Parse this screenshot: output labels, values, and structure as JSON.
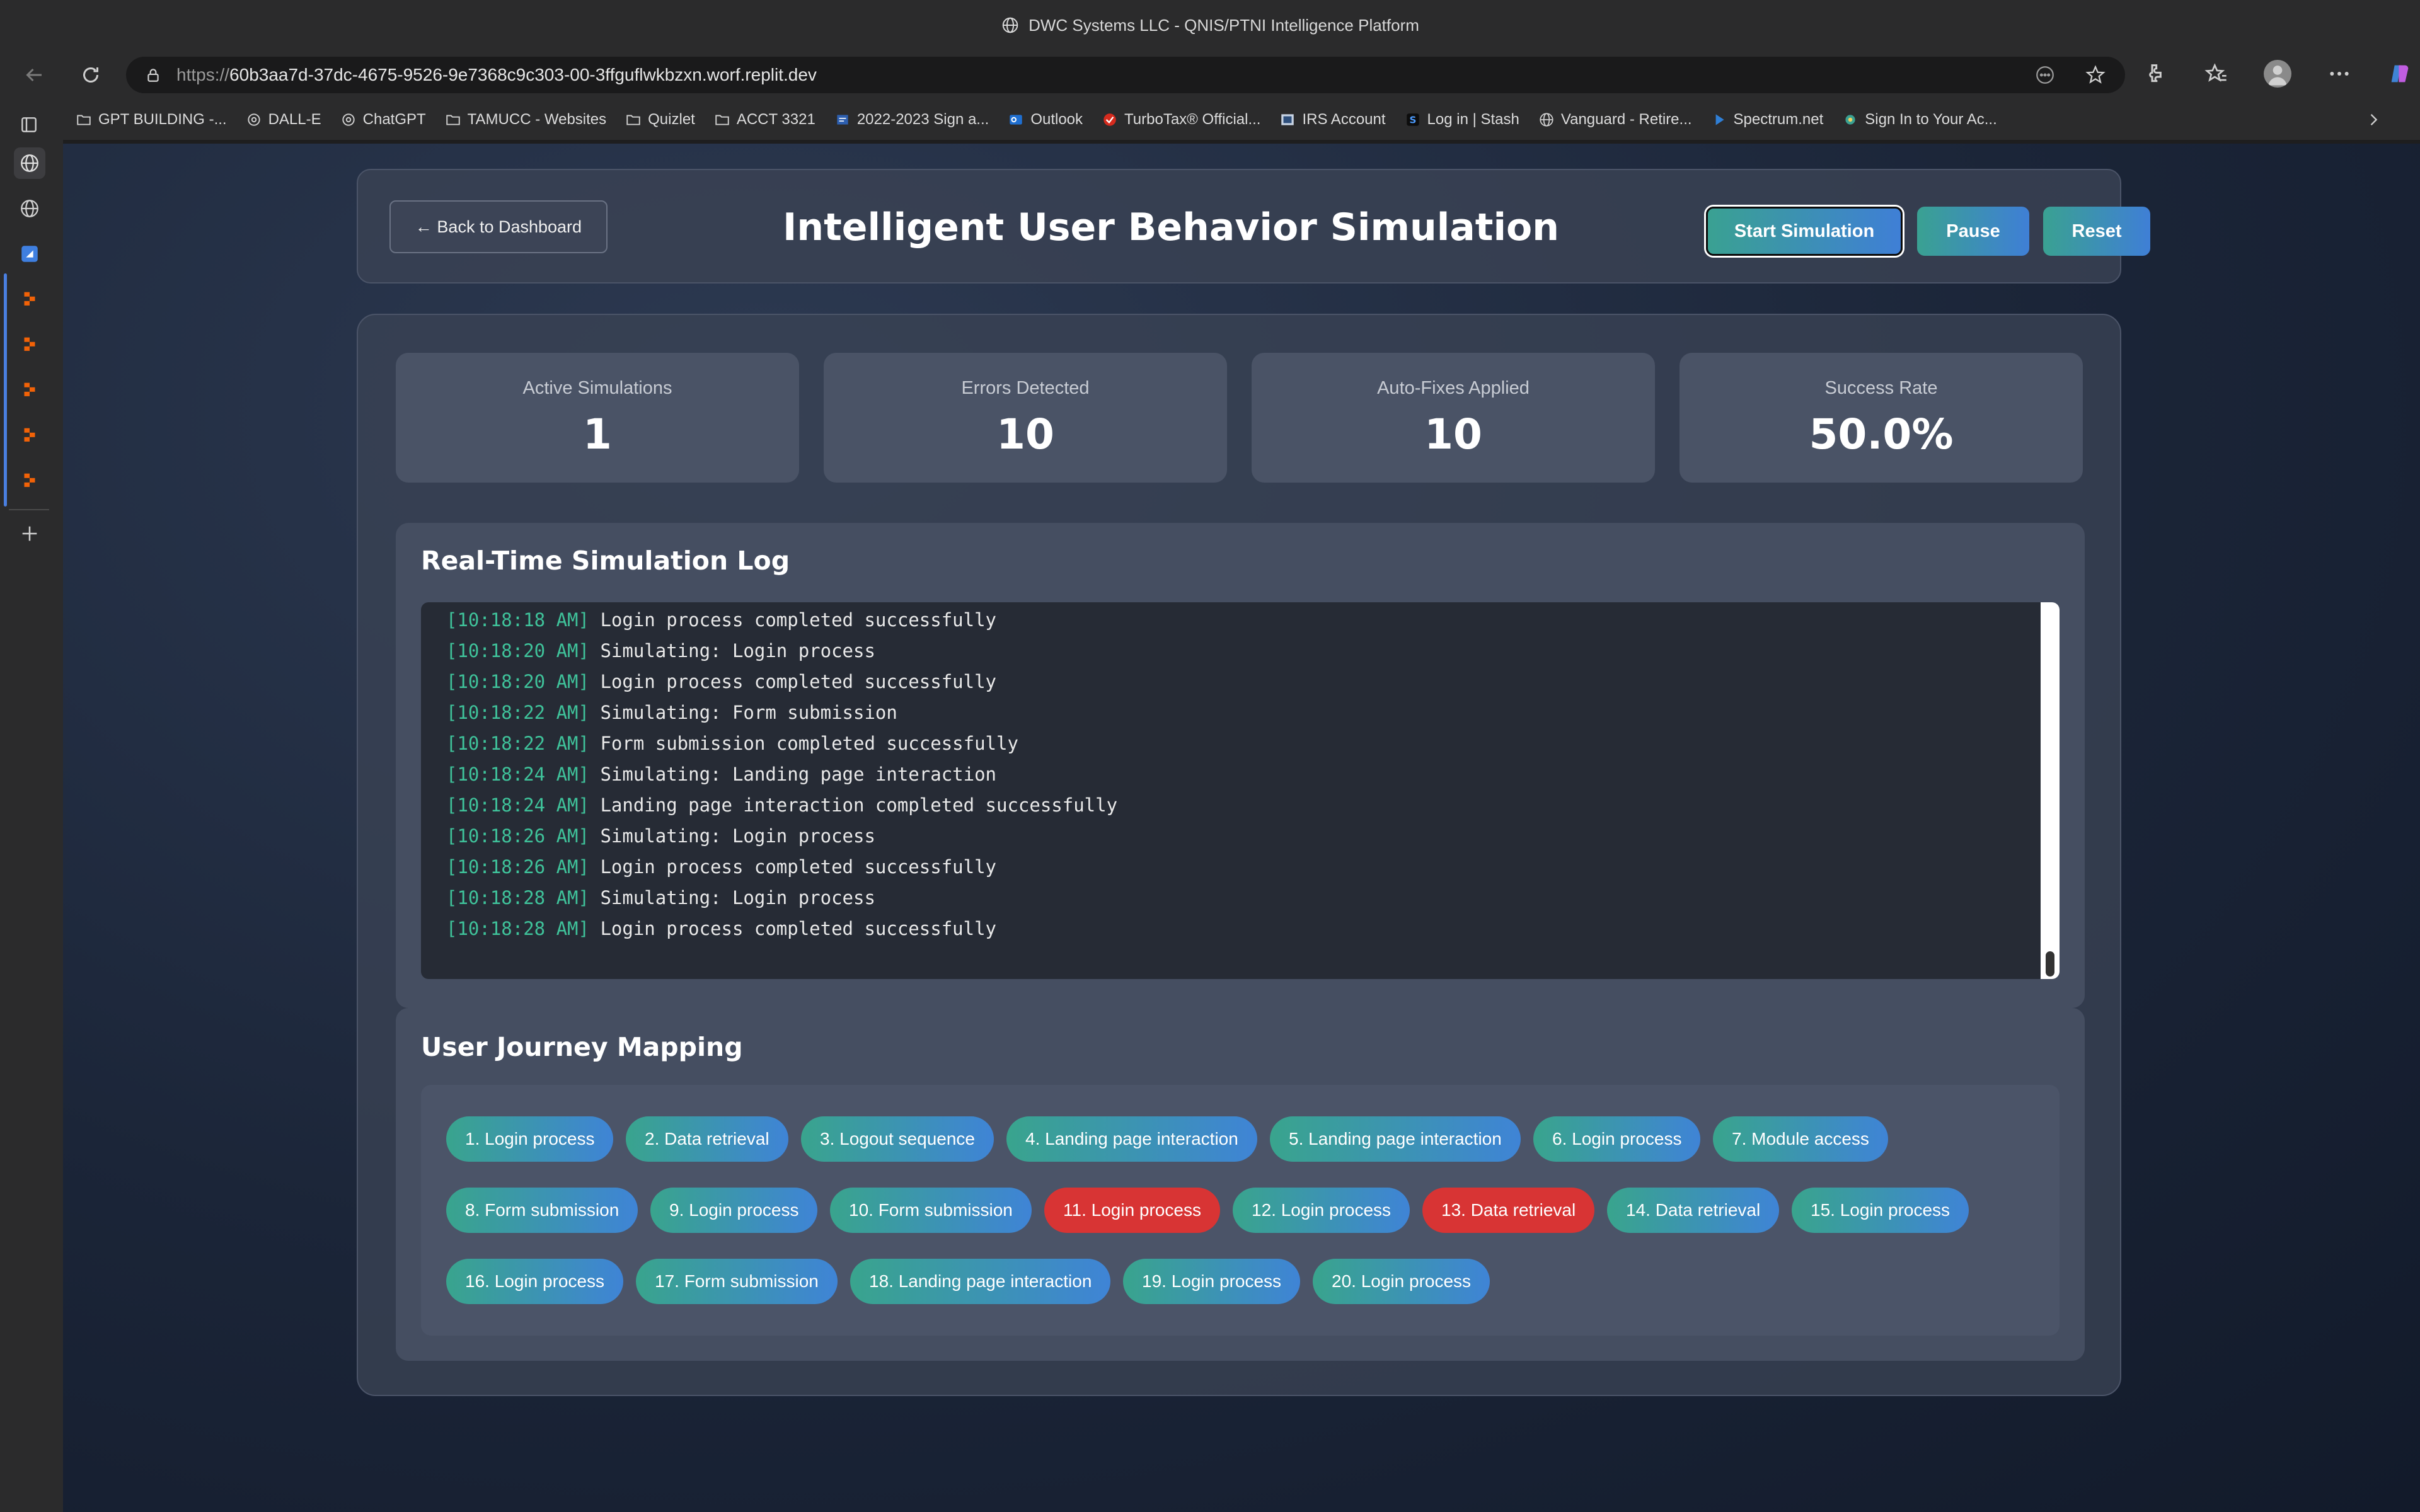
{
  "window": {
    "title": "DWC Systems LLC - QNIS/PTNI Intelligence Platform",
    "url_protocol": "https://",
    "url_rest": "60b3aa7d-37dc-4675-9526-9e7368c9c303-00-3ffguflwkbzxn.worf.replit.dev"
  },
  "bookmarks": [
    {
      "label": "GPT BUILDING -...",
      "icon": "folder-icon"
    },
    {
      "label": "DALL-E",
      "icon": "openai-icon"
    },
    {
      "label": "ChatGPT",
      "icon": "openai-icon"
    },
    {
      "label": "TAMUCC - Websites",
      "icon": "folder-icon"
    },
    {
      "label": "Quizlet",
      "icon": "folder-icon"
    },
    {
      "label": "ACCT 3321",
      "icon": "folder-icon"
    },
    {
      "label": "2022-2023 Sign a...",
      "icon": "doc-icon"
    },
    {
      "label": "Outlook",
      "icon": "outlook-icon"
    },
    {
      "label": "TurboTax® Official...",
      "icon": "turbotax-icon"
    },
    {
      "label": "IRS Account",
      "icon": "irs-icon"
    },
    {
      "label": "Log in | Stash",
      "icon": "stash-icon"
    },
    {
      "label": "Vanguard - Retire...",
      "icon": "globe-icon"
    },
    {
      "label": "Spectrum.net",
      "icon": "play-icon"
    },
    {
      "label": "Sign In to Your Ac...",
      "icon": "sparkle-icon"
    }
  ],
  "header": {
    "back_label": "← Back to Dashboard",
    "title": "Intelligent User Behavior Simulation",
    "start_label": "Start Simulation",
    "pause_label": "Pause",
    "reset_label": "Reset"
  },
  "stats": [
    {
      "label": "Active Simulations",
      "value": "1"
    },
    {
      "label": "Errors Detected",
      "value": "10"
    },
    {
      "label": "Auto-Fixes Applied",
      "value": "10"
    },
    {
      "label": "Success Rate",
      "value": "50.0%"
    }
  ],
  "log": {
    "title": "Real-Time Simulation Log",
    "entries": [
      {
        "time": "[10:18:18 AM]",
        "message": "Login process completed successfully"
      },
      {
        "time": "[10:18:20 AM]",
        "message": "Simulating: Login process"
      },
      {
        "time": "[10:18:20 AM]",
        "message": "Login process completed successfully"
      },
      {
        "time": "[10:18:22 AM]",
        "message": "Simulating: Form submission"
      },
      {
        "time": "[10:18:22 AM]",
        "message": "Form submission completed successfully"
      },
      {
        "time": "[10:18:24 AM]",
        "message": "Simulating: Landing page interaction"
      },
      {
        "time": "[10:18:24 AM]",
        "message": "Landing page interaction completed successfully"
      },
      {
        "time": "[10:18:26 AM]",
        "message": "Simulating: Login process"
      },
      {
        "time": "[10:18:26 AM]",
        "message": "Login process completed successfully"
      },
      {
        "time": "[10:18:28 AM]",
        "message": "Simulating: Login process"
      },
      {
        "time": "[10:18:28 AM]",
        "message": "Login process completed successfully"
      }
    ]
  },
  "journey": {
    "title": "User Journey Mapping",
    "steps": [
      {
        "label": "1. Login process",
        "status": "ok"
      },
      {
        "label": "2. Data retrieval",
        "status": "ok"
      },
      {
        "label": "3. Logout sequence",
        "status": "ok"
      },
      {
        "label": "4. Landing page interaction",
        "status": "ok"
      },
      {
        "label": "5. Landing page interaction",
        "status": "ok"
      },
      {
        "label": "6. Login process",
        "status": "ok"
      },
      {
        "label": "7. Module access",
        "status": "ok"
      },
      {
        "label": "8. Form submission",
        "status": "ok"
      },
      {
        "label": "9. Login process",
        "status": "ok"
      },
      {
        "label": "10. Form submission",
        "status": "ok"
      },
      {
        "label": "11. Login process",
        "status": "error"
      },
      {
        "label": "12. Login process",
        "status": "ok"
      },
      {
        "label": "13. Data retrieval",
        "status": "error"
      },
      {
        "label": "14. Data retrieval",
        "status": "ok"
      },
      {
        "label": "15. Login process",
        "status": "ok"
      },
      {
        "label": "16. Login process",
        "status": "ok"
      },
      {
        "label": "17. Form submission",
        "status": "ok"
      },
      {
        "label": "18. Landing page interaction",
        "status": "ok"
      },
      {
        "label": "19. Login process",
        "status": "ok"
      },
      {
        "label": "20. Login process",
        "status": "ok"
      }
    ]
  },
  "colors": {
    "accent_teal": "#39a48d",
    "accent_blue": "#3f84d6",
    "error_red": "#d83434",
    "timestamp_green": "#3fc29a"
  }
}
